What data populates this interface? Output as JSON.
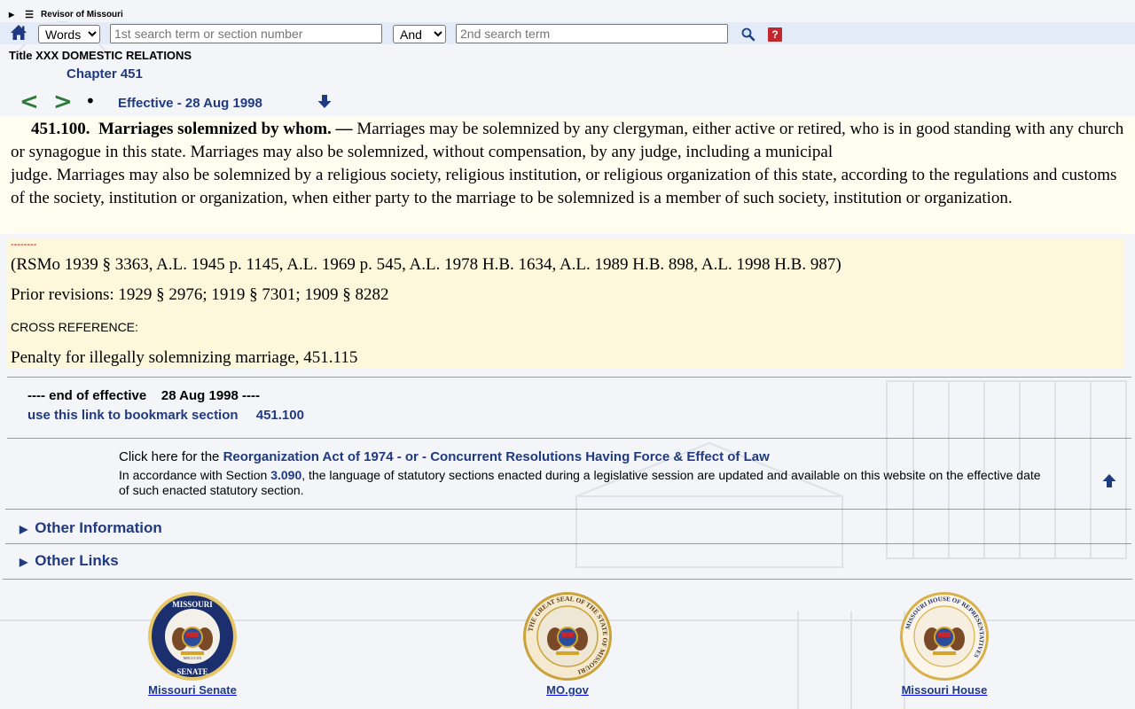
{
  "header": {
    "site_name": "Revisor of Missouri",
    "search": {
      "mode_options": [
        "Words"
      ],
      "mode_selected": "Words",
      "term1_placeholder": "1st search term or section number",
      "term1_value": "",
      "operator_selected": "And",
      "term2_placeholder": "2nd search term",
      "term2_value": "",
      "help_label": "?"
    },
    "icons": [
      "home-icon",
      "search-icon",
      "help-icon"
    ]
  },
  "location": {
    "title": "Title XXX DOMESTIC RELATIONS",
    "chapter": "Chapter 451"
  },
  "nav": {
    "prev": "<",
    "next": ">",
    "dot": "•",
    "effective": "Effective - 28 Aug 1998"
  },
  "section": {
    "number": "451.100.",
    "heading": "Marriages solemnized by whom. —",
    "text1": "Marriages may be solemnized by any clergyman, either active or retired, who is in good standing with any church or synagogue in this state.  Marriages may also be solemnized, without compensation, by any judge, including a municipal",
    "text2": "judge.  Marriages may also be solemnized by a religious society, religious institution, or religious organization of this state, according to the regulations and customs of the society, institution or organization, when either party to the marriage to be solemnized is a member of such society, institution or organization."
  },
  "history": {
    "dashes": "--------",
    "citation": "(RSMo 1939 § 3363, A.L. 1945 p. 1145, A.L. 1969 p. 545, A.L. 1978 H.B. 1634, A.L. 1989 H.B. 898, A.L. 1998 H.B. 987)",
    "prior": "Prior revisions: 1929 § 2976; 1919 § 7301; 1909 § 8282",
    "cross_ref_label": "CROSS REFERENCE:",
    "cross_ref": "Penalty for illegally solemnizing marriage, 451.115"
  },
  "end": {
    "prefix": "---- end of effective",
    "date": "28 Aug 1998",
    "suffix": "----",
    "bookmark_text": "use this link to bookmark section",
    "bookmark_section": "451.100"
  },
  "notice": {
    "click_prefix": "Click here for the",
    "click_link": "Reorganization Act of 1974 - or - Concurrent Resolutions Having Force & Effect of Law",
    "acc_prefix": "In accordance with Section",
    "acc_link": "3.090",
    "acc_suffix": ", the language of statutory sections enacted during a legislative session are updated and available on this website on the effective date of such enacted statutory section."
  },
  "accordions": {
    "other_info": "Other Information",
    "other_links": "Other Links"
  },
  "footer": {
    "senate": {
      "label": "Missouri Senate",
      "seal_top": "MISSOURI",
      "seal_bottom": "SENATE",
      "seal_year": "MDCCCXX"
    },
    "mogov": {
      "label": "MO.gov",
      "seal_ring": "THE GREAT SEAL OF THE STATE OF MISSOURI"
    },
    "house": {
      "label": "Missouri House",
      "seal_ring": "MISSOURI HOUSE OF REPRESENTATIVES"
    }
  },
  "colors": {
    "link": "#1f3a80",
    "search_bar": "#e2ebf7",
    "section_bg": "#fffdf0",
    "history_bg": "#fdf7dc",
    "help": "#c1272d",
    "nav_arrows": "#2f7a3a"
  }
}
